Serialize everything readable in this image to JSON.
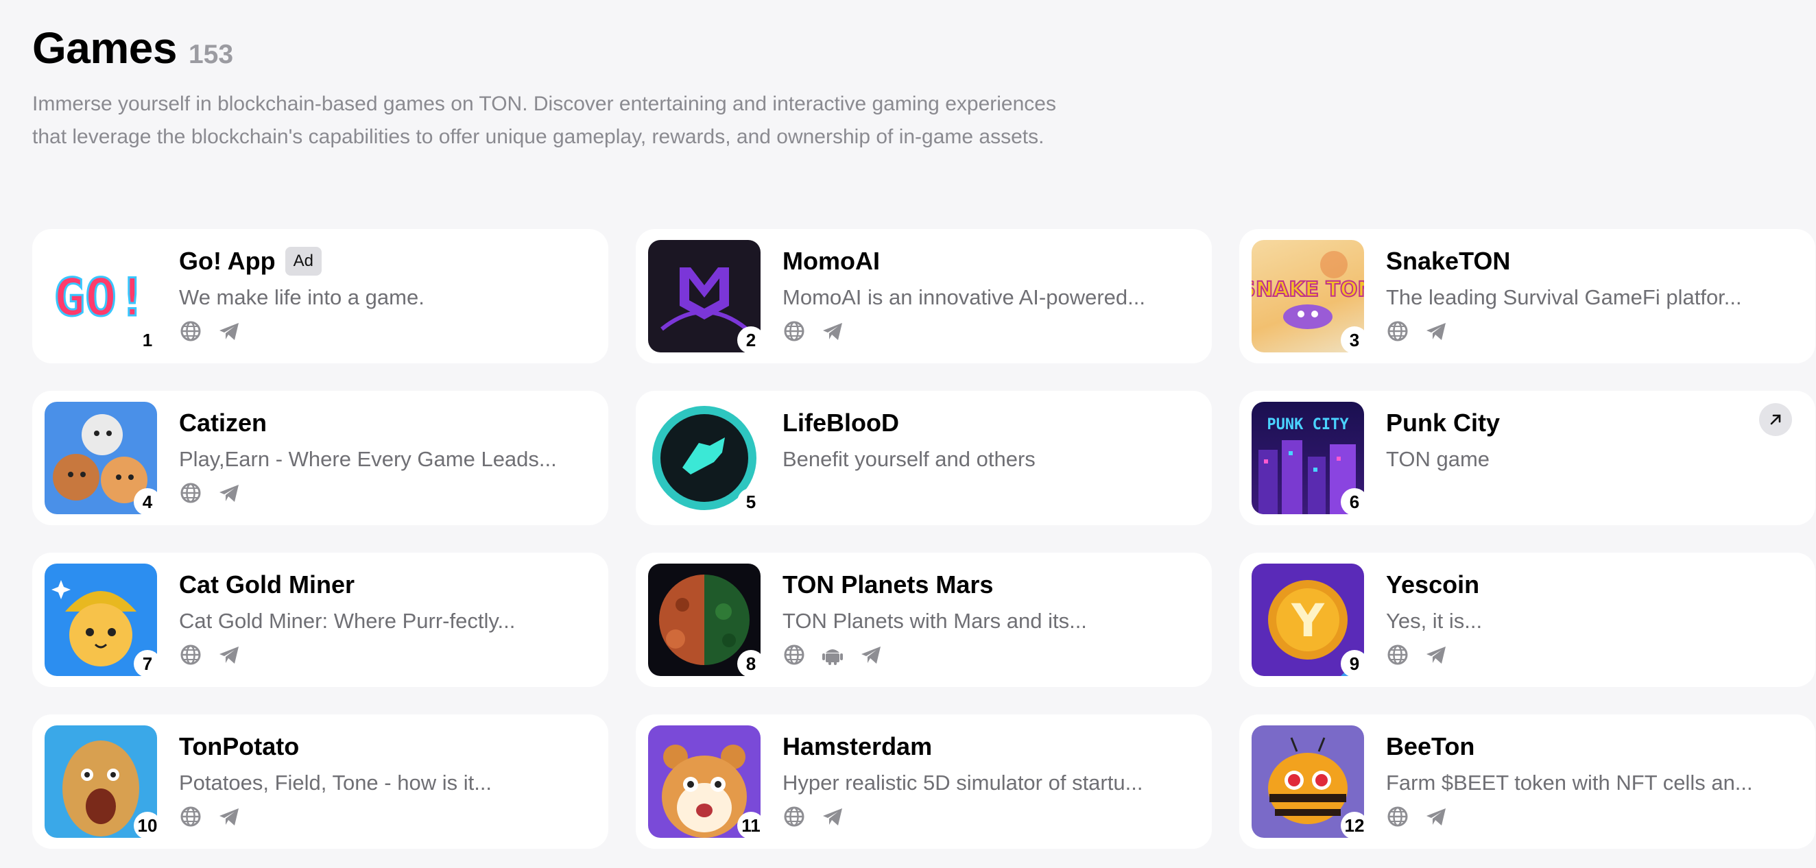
{
  "header": {
    "title": "Games",
    "count": "153",
    "description": "Immerse yourself in blockchain-based games on TON. Discover entertaining and interactive gaming experiences that leverage the blockchain's capabilities to offer unique gameplay, rewards, and ownership of in-game assets."
  },
  "colors": {
    "background": "#f6f6f8",
    "card": "#ffffff",
    "muted_text": "#8a8a90",
    "icon_gray": "#8e8e93"
  },
  "apps": [
    {
      "rank": "1",
      "name": "Go! App",
      "badge": "Ad",
      "subtitle": "We make life into a game.",
      "icon": "go-app-logo",
      "icon_text": "GO!",
      "links": [
        "globe-icon",
        "telegram-icon"
      ]
    },
    {
      "rank": "2",
      "name": "MomoAI",
      "subtitle": "MomoAI is an innovative AI-powered...",
      "icon": "momoai-logo",
      "links": [
        "globe-icon",
        "telegram-icon"
      ]
    },
    {
      "rank": "3",
      "name": "SnakeTON",
      "subtitle": "The leading Survival GameFi platfor...",
      "icon": "snaketon-logo",
      "icon_text": "SNAKE TON",
      "links": [
        "globe-icon",
        "telegram-icon"
      ]
    },
    {
      "rank": "4",
      "name": "Catizen",
      "subtitle": "Play,Earn - Where Every Game Leads...",
      "icon": "catizen-logo",
      "links": [
        "globe-icon",
        "telegram-icon"
      ]
    },
    {
      "rank": "5",
      "name": "LifeBlooD",
      "subtitle": "Benefit yourself and others",
      "icon": "lifeblood-logo",
      "links": []
    },
    {
      "rank": "6",
      "name": "Punk City",
      "subtitle": "TON game",
      "icon": "punk-city-logo",
      "icon_text": "PUNK CITY",
      "links": [],
      "external": "arrow-up-right-icon"
    },
    {
      "rank": "7",
      "name": "Cat Gold Miner",
      "subtitle": "Cat Gold Miner: Where Purr-fectly...",
      "icon": "cat-gold-miner-logo",
      "links": [
        "globe-icon",
        "telegram-icon"
      ]
    },
    {
      "rank": "8",
      "name": "TON Planets Mars",
      "subtitle": "TON Planets with Mars and its...",
      "icon": "ton-planets-mars-logo",
      "links": [
        "globe-icon",
        "android-icon",
        "telegram-icon"
      ]
    },
    {
      "rank": "9",
      "name": "Yescoin",
      "subtitle": "Yes, it is...",
      "icon": "yescoin-logo",
      "icon_text": "Y",
      "links": [
        "globe-icon",
        "telegram-icon"
      ]
    },
    {
      "rank": "10",
      "name": "TonPotato",
      "subtitle": "Potatoes, Field, Tone - how is it...",
      "icon": "tonpotato-logo",
      "links": [
        "globe-icon",
        "telegram-icon"
      ]
    },
    {
      "rank": "11",
      "name": "Hamsterdam",
      "subtitle": "Hyper realistic 5D simulator of startu...",
      "icon": "hamsterdam-logo",
      "links": [
        "globe-icon",
        "telegram-icon"
      ]
    },
    {
      "rank": "12",
      "name": "BeeTon",
      "subtitle": "Farm $BEET token with NFT cells an...",
      "icon": "beeton-logo",
      "links": [
        "globe-icon",
        "telegram-icon"
      ]
    }
  ]
}
